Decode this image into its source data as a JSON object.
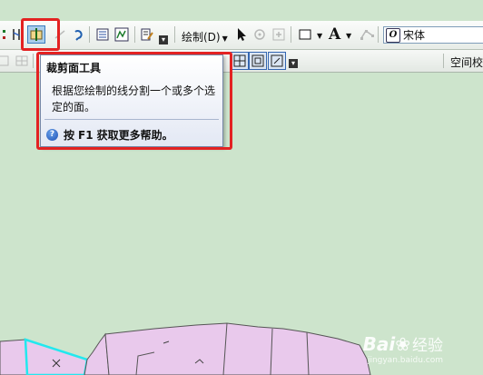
{
  "toolbar": {
    "draw_menu_label": "绘制(D)",
    "font_name": "宋体",
    "text_tool_label": "A",
    "spatial_label": "空间校"
  },
  "tooltip": {
    "title": "裁剪面工具",
    "description": "根据您绘制的线分割一个或多个选定的面。",
    "help_prefix": "按",
    "help_key": "F1",
    "help_suffix": "获取更多帮助。"
  },
  "watermark": {
    "brand": "Bai",
    "brand_suffix": "经验",
    "url": "jingyan.baidu.com"
  },
  "colors": {
    "map_background": "#cde4cc",
    "polygon_fill": "#e9c9ec",
    "selected_outline": "#22e8ee",
    "highlight_box": "#e32222"
  }
}
